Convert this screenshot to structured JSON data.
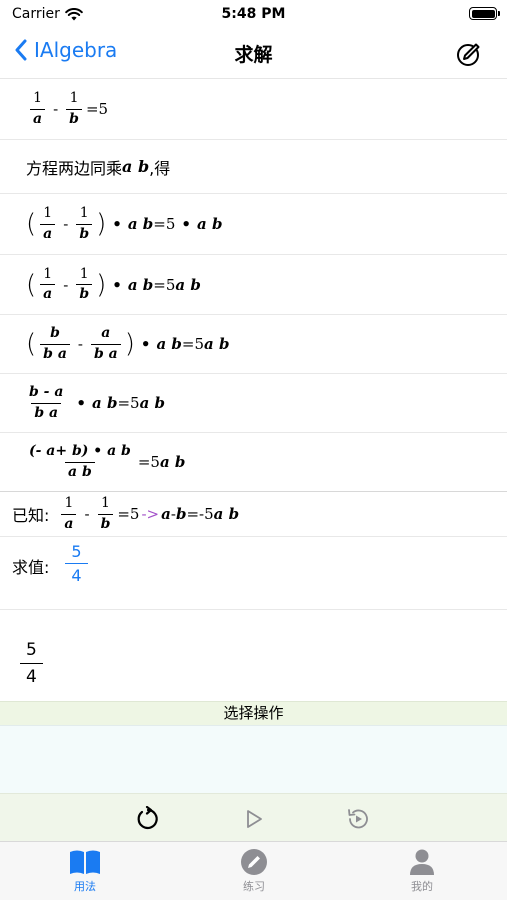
{
  "status_bar": {
    "carrier": "Carrier",
    "time": "5:48 PM"
  },
  "nav": {
    "back_label": "IAlgebra",
    "title": "求解",
    "action_icon": "compose-circle-icon"
  },
  "steps": {
    "s1": {
      "n1": "1",
      "d1": "a",
      "minus": "-",
      "n2": "1",
      "d2": "b",
      "rhs": "=5"
    },
    "s2": {
      "text": "方程两边同乘",
      "vars": "a b",
      "tail": ",得"
    },
    "s3": {
      "lp": "(",
      "n1": "1",
      "d1": "a",
      "minus": "-",
      "n2": "1",
      "d2": "b",
      "rp": ")",
      "dot1": "•",
      "ab1": "a b",
      "eq": "=5",
      "dot2": "•",
      "ab2": "a b"
    },
    "s4": {
      "lp": "(",
      "n1": "1",
      "d1": "a",
      "minus": "-",
      "n2": "1",
      "d2": "b",
      "rp": ")",
      "dot": "•",
      "ab": "a b",
      "rhs": "=5",
      "ab2": "a b"
    },
    "s5": {
      "lp": "(",
      "n1": "b",
      "d1": "b a",
      "minus": "-",
      "n2": "a",
      "d2": "b a",
      "rp": ")",
      "dot": "•",
      "ab": "a b",
      "rhs": "=5",
      "ab2": "a b"
    },
    "s6": {
      "num": "b - a",
      "den": "b a",
      "dot": "•",
      "ab": "a b",
      "rhs": "=5",
      "ab2": "a b"
    },
    "s7": {
      "num": "(- a+ b) • a b",
      "den": "a b",
      "rhs": "=5",
      "ab2": "a b"
    }
  },
  "known": {
    "label": "已知:",
    "n1": "1",
    "d1": "a",
    "minus": "-",
    "n2": "1",
    "d2": "b",
    "eq": "=5",
    "arrow": "->",
    "result_vars1": "a",
    "result_minus": "- ",
    "result_vars2": "b",
    "result_rhs": "=-5",
    "result_ab": "a b"
  },
  "solve": {
    "label": "求值:",
    "num": "5",
    "den": "4"
  },
  "result": {
    "num": "5",
    "den": "4"
  },
  "operation": {
    "header": "选择操作"
  },
  "controls": {
    "icons": [
      "rotate-icon",
      "play-icon",
      "replay-icon"
    ]
  },
  "tabs": [
    {
      "label": "用法",
      "icon": "book-icon",
      "active": true
    },
    {
      "label": "练习",
      "icon": "pencil-circle-icon",
      "active": false
    },
    {
      "label": "我的",
      "icon": "person-icon",
      "active": false
    }
  ],
  "colors": {
    "accent": "#1a7bf2",
    "arrow": "#a24fc9",
    "op_header_bg": "#eef6e4",
    "tab_inactive": "#8e8e93"
  }
}
